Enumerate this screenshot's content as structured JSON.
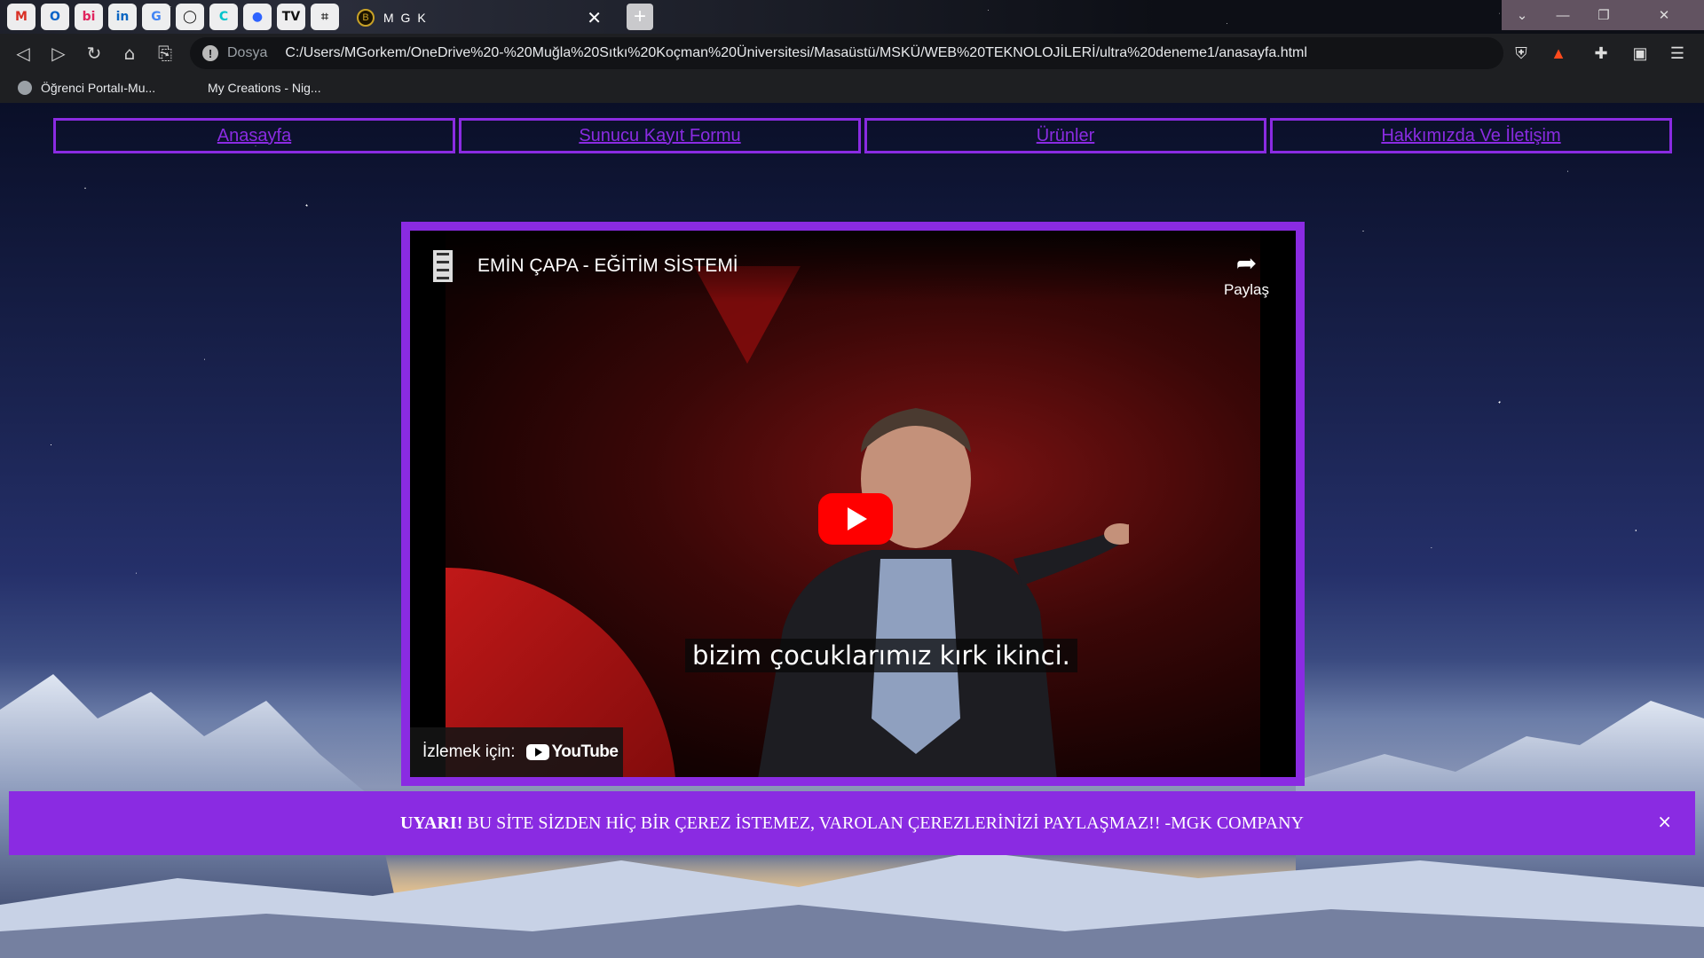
{
  "browser": {
    "pinned_tabs": [
      {
        "name": "gmail-icon",
        "glyph": "M",
        "color": "#d93025"
      },
      {
        "name": "outlook-icon",
        "glyph": "O",
        "color": "#0a64c8"
      },
      {
        "name": "bi-icon",
        "glyph": "bi",
        "color": "#e0245e"
      },
      {
        "name": "linkedin-icon",
        "glyph": "in",
        "color": "#0a66c2"
      },
      {
        "name": "translate-icon",
        "glyph": "G",
        "color": "#4285f4"
      },
      {
        "name": "github-icon",
        "glyph": "◯",
        "color": "#111111"
      },
      {
        "name": "canva-icon",
        "glyph": "C",
        "color": "#00c4cc"
      },
      {
        "name": "messenger-icon",
        "glyph": "●",
        "color": "#2e63ff"
      },
      {
        "name": "tv-icon",
        "glyph": "TV",
        "color": "#111111"
      },
      {
        "name": "crop-icon",
        "glyph": "⌗",
        "color": "#333333"
      }
    ],
    "active_tab": {
      "title": "M G K",
      "favicon": "B"
    },
    "new_tab_label": "+",
    "window_controls": {
      "chevron": "⌄",
      "minimize": "—",
      "restore": "❐",
      "close": "✕"
    },
    "nav": {
      "back": "◁",
      "forward": "▷",
      "reload": "↻",
      "home": "⌂",
      "bookmark": "⎘"
    },
    "address": {
      "info": "!",
      "scheme": "Dosya",
      "url": "C:/Users/MGorkem/OneDrive%20-%20Muğla%20Sıtkı%20Koçman%20Üniversitesi/Masaüstü/MSKÜ/WEB%20TEKNOLOJİLERİ/ultra%20deneme1/anasayfa.html"
    },
    "toolbar_right": {
      "shield": "⛨",
      "rewards": "▲",
      "extensions": "✚",
      "wallet": "▣",
      "menu": "☰"
    },
    "bookmarks": [
      {
        "label": "Öğrenci Portalı-Mu..."
      },
      {
        "label": "My Creations - Nig..."
      }
    ]
  },
  "site": {
    "nav": [
      "Anasayfa",
      "Sunucu Kayıt Formu",
      "Ürünler",
      "Hakkımızda Ve İletişim"
    ],
    "accent": "#8a2be2",
    "video": {
      "title": "EMİN ÇAPA - EĞİTİM SİSTEMİ",
      "share_label": "Paylaş",
      "share_icon": "➦",
      "caption": "bizim çocuklarımız kırk ikinci.",
      "watch_label": "İzlemek için:",
      "youtube_label": "YouTube"
    },
    "banner": {
      "bold": "UYARI!",
      "text": " BU SİTE SİZDEN HİÇ BİR ÇEREZ İSTEMEZ, VAROLAN ÇEREZLERİNİZİ PAYLAŞMAZ!! -MGK COMPANY",
      "close": "×"
    }
  }
}
